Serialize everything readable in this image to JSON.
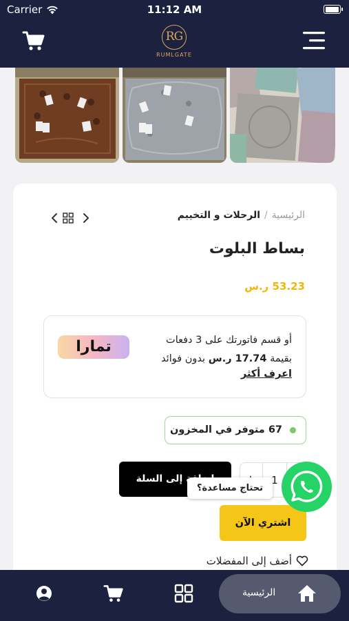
{
  "status_bar": {
    "carrier": "Carrier",
    "time": "11:12 AM"
  },
  "header": {
    "logo_letters": "RG",
    "logo_wordmark": "RUMLGATE"
  },
  "breadcrumb": {
    "home": "الرئيسية",
    "separator": "/",
    "current": "الرحلات و التخييم"
  },
  "product": {
    "title": "بساط البلوت",
    "price": "53.23 ر.س",
    "stock": "67 متوفر في المخزون",
    "quantity": "1",
    "quantity_plus": "+",
    "add_to_cart": "إضافة إلى السلة",
    "buy_now": "اشتري الآن",
    "wishlist": "أضف إلى المفضلات"
  },
  "tamara": {
    "line1": "أو قسم فاتورتك على 3 دفعات",
    "line2_prefix": "بقيمة",
    "line2_amount": "17.74 ر.س",
    "line2_suffix": "بدون فوائد",
    "learn_more": "اعرف أكثر",
    "brand": "تمارا"
  },
  "whatsapp": {
    "bubble": "تحتاج مساعدة؟"
  },
  "bottom_nav": {
    "home_label": "الرئيسية"
  },
  "colors": {
    "navy": "#1c2140",
    "accent_yellow": "#f5c518",
    "price_yellow": "#f2b705",
    "whatsapp_green": "#25d366",
    "stock_green": "#7bc86c"
  }
}
